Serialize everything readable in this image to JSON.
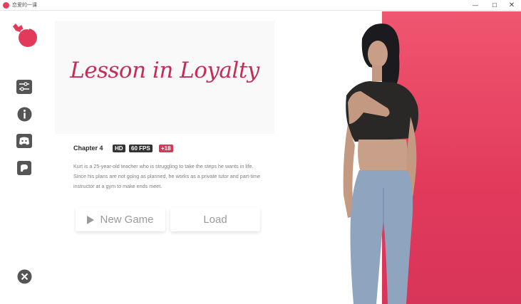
{
  "window": {
    "title": "恋爱的一课",
    "controls": {
      "minimize": "—",
      "maximize": "☐",
      "close": "✕"
    }
  },
  "game": {
    "title": "Lesson in Loyalty",
    "chapter": "Chapter 4",
    "tags": {
      "hd": "HD",
      "fps": "60 FPS",
      "age": "+18"
    },
    "description": "Kurt is a 25-year-old teacher who is struggling to take the steps he wants in life. Since his plans are not going as planned, he works as a private tutor and part-time instructor at a gym to make ends meet."
  },
  "buttons": {
    "new_game": "New Game",
    "load": "Load"
  },
  "sidebar": {
    "items": [
      {
        "icon": "settings-sliders-icon"
      },
      {
        "icon": "info-icon"
      },
      {
        "icon": "discord-icon"
      },
      {
        "icon": "patreon-icon"
      },
      {
        "icon": "close-icon"
      }
    ]
  },
  "colors": {
    "accent": "#e13a5b",
    "title": "#c42e56",
    "icon": "#555555"
  }
}
